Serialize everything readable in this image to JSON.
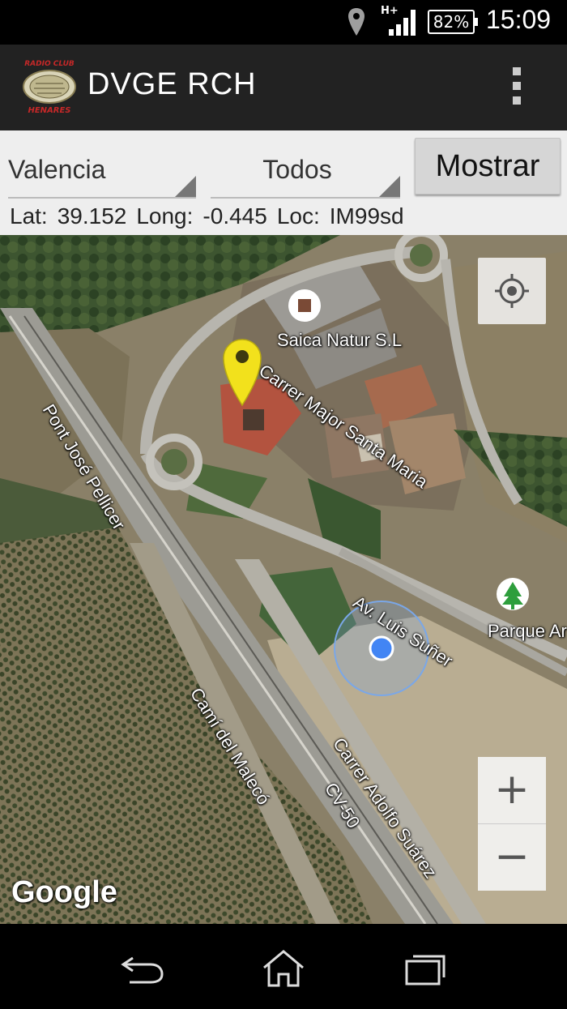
{
  "status_bar": {
    "network_type": "H+",
    "battery": "82%",
    "time": "15:09",
    "icons": [
      "location-icon",
      "signal-icon",
      "battery-icon"
    ]
  },
  "app_bar": {
    "title": "DVGE RCH",
    "logo_text_top": "RADIO CLUB",
    "logo_text_bottom": "HENARES",
    "overflow_icon": "more-vert-icon"
  },
  "controls": {
    "region_selected": "Valencia",
    "type_selected": "Todos",
    "show_button": "Mostrar",
    "lat_label": "Lat:",
    "lat_value": "39.152",
    "long_label": "Long:",
    "long_value": "-0.445",
    "loc_label": "Loc:",
    "loc_value": "IM99sd"
  },
  "map": {
    "labels": {
      "poi_business": "Saica Natur S.L",
      "street_1": "Carrer Major Santa Maria",
      "street_2": "Pont José Pellicer",
      "street_3": "Av. Luis Suñer",
      "street_4": "Camí del Malecó",
      "street_5": "Carrer Adolfo Suárez",
      "road_cv": "CV-50",
      "park": "Parque Ar"
    },
    "attribution": "Google",
    "zoom_in_label": "+",
    "zoom_out_label": "−",
    "colors": {
      "marker": "#f2e11c",
      "my_location": "#4285f4",
      "accuracy_circle": "#7aa7e8"
    }
  },
  "nav_bar": {
    "buttons": [
      "back-icon",
      "home-icon",
      "recents-icon"
    ]
  }
}
